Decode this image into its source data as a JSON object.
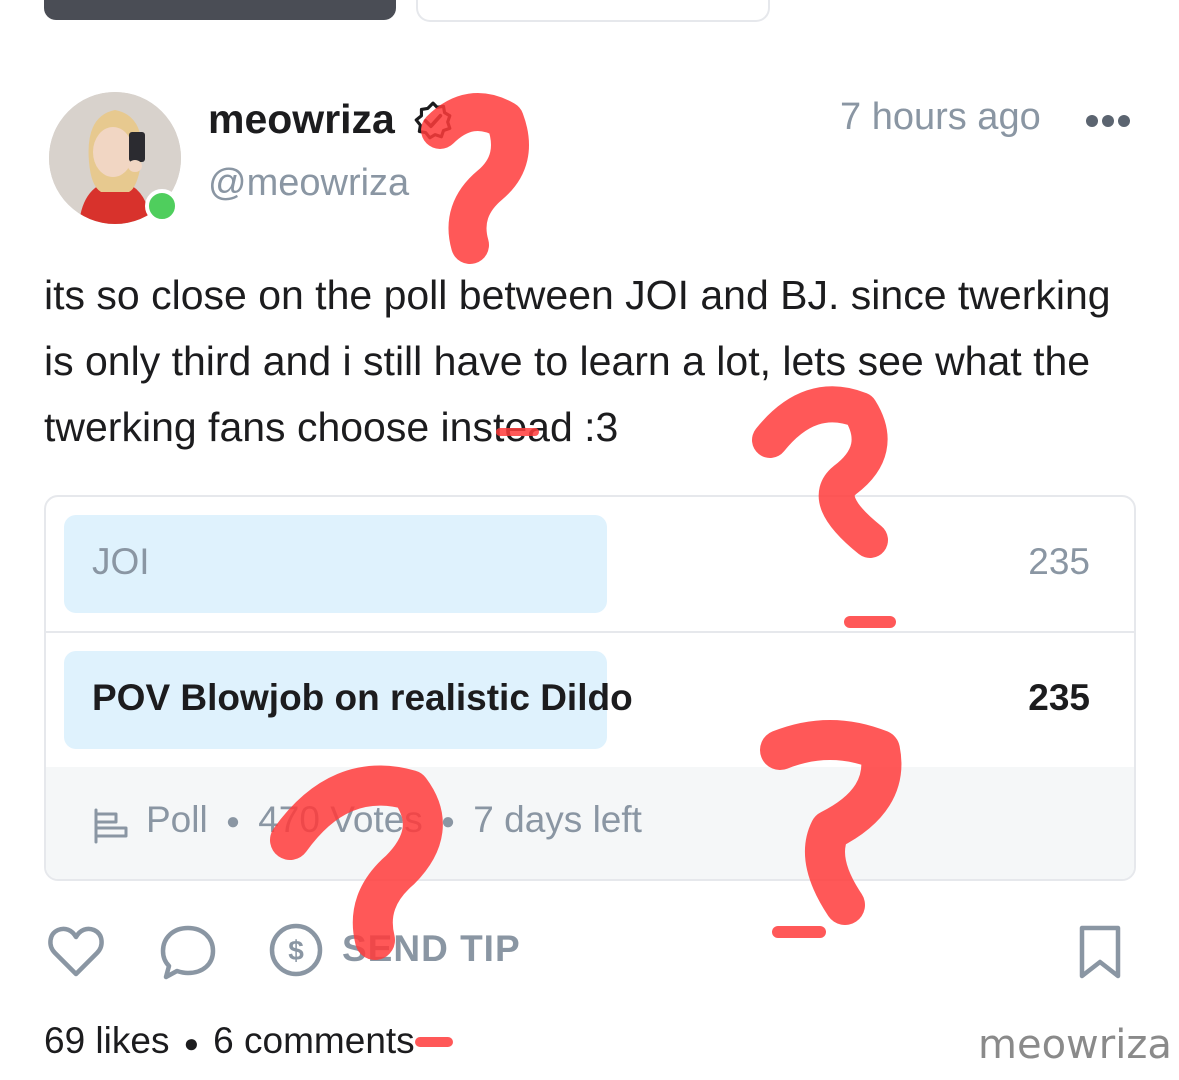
{
  "post": {
    "username": "meowriza",
    "handle": "@meowriza",
    "timestamp": "7 hours ago",
    "text": "its so close on the poll between JOI and BJ. since twerking is only third and i still have to learn a lot, lets see what the twerking fans choose instead :3"
  },
  "poll": {
    "options": [
      {
        "label": "JOI",
        "count": "235",
        "share": 0.5
      },
      {
        "label": "POV Blowjob on realistic Dildo",
        "count": "235",
        "share": 0.5
      }
    ],
    "type_label": "Poll",
    "votes": "470 Votes",
    "time_left": "7 days left"
  },
  "actions": {
    "tip_label": "SEND TIP",
    "icons": [
      "heart-icon",
      "comment-icon",
      "dollar-icon",
      "bookmark-icon"
    ]
  },
  "stats": {
    "likes": "69 likes",
    "comments": "6 comments"
  },
  "watermark": "meowriza",
  "colors": {
    "muted": "#8a96a3",
    "poll_bar": "#dff2fd",
    "online": "#4fce5d",
    "annotation": "#ff3b3b"
  }
}
